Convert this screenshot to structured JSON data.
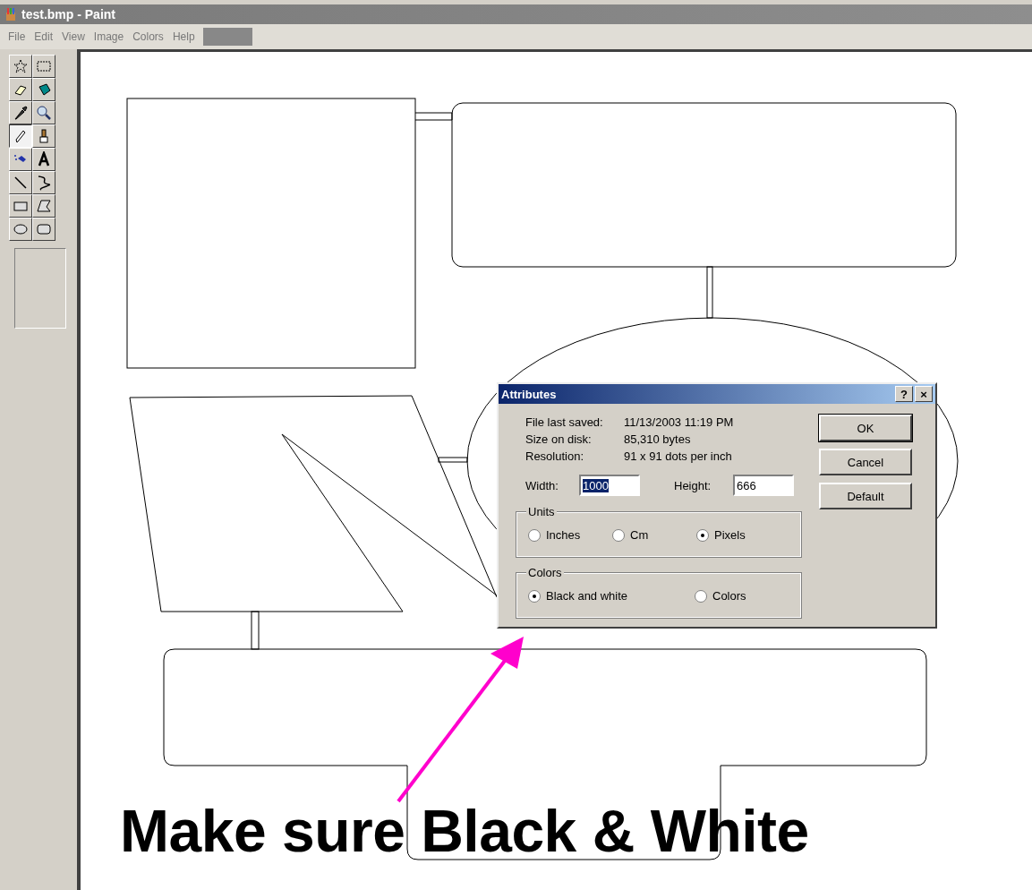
{
  "window": {
    "title": "test.bmp - Paint"
  },
  "menu": [
    "File",
    "Edit",
    "View",
    "Image",
    "Colors",
    "Help"
  ],
  "tools": [
    {
      "selected": false
    },
    {
      "selected": false
    },
    {
      "selected": false
    },
    {
      "selected": false
    },
    {
      "selected": false
    },
    {
      "selected": false
    },
    {
      "selected": true
    },
    {
      "selected": false
    },
    {
      "selected": false
    },
    {
      "selected": false
    },
    {
      "selected": false
    },
    {
      "selected": false
    },
    {
      "selected": false
    },
    {
      "selected": false
    },
    {
      "selected": false
    },
    {
      "selected": false
    }
  ],
  "dialog": {
    "title": "Attributes",
    "title_buttons": [
      "?",
      "×"
    ],
    "info": [
      {
        "label": "File last saved:",
        "value": "11/13/2003 11:19 PM"
      },
      {
        "label": "Size on disk:",
        "value": "85,310 bytes"
      },
      {
        "label": "Resolution:",
        "value": "91 x 91 dots per inch"
      }
    ],
    "width": {
      "label": "Width:",
      "value": "1000",
      "selected": true
    },
    "height": {
      "label": "Height:",
      "value": "666",
      "selected": false
    },
    "groups": [
      {
        "label": "Units",
        "options": [
          {
            "label": "Inches",
            "selected": false
          },
          {
            "label": "Cm",
            "selected": false
          },
          {
            "label": "Pixels",
            "selected": true
          }
        ]
      },
      {
        "label": "Colors",
        "options": [
          {
            "label": "Black and white",
            "selected": true
          },
          {
            "label": "Colors",
            "selected": false
          }
        ]
      }
    ],
    "buttons": [
      {
        "label": "OK",
        "default": true
      },
      {
        "label": "Cancel",
        "default": false
      },
      {
        "label": "Default",
        "default": false
      }
    ]
  },
  "annotation": "Make sure Black & White"
}
